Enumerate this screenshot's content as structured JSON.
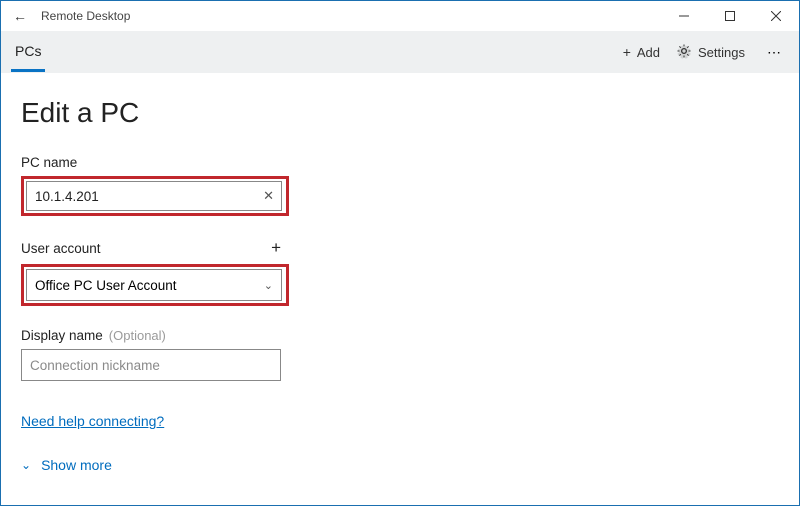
{
  "titlebar": {
    "app_name": "Remote Desktop"
  },
  "commandbar": {
    "tab_label": "PCs",
    "add_label": "Add",
    "settings_label": "Settings"
  },
  "page": {
    "title": "Edit a PC",
    "pc_name_label": "PC name",
    "pc_name_value": "10.1.4.201",
    "user_account_label": "User account",
    "user_account_value": "Office PC User Account",
    "display_name_label": "Display name",
    "display_name_optional": "(Optional)",
    "display_name_placeholder": "Connection nickname",
    "help_link_label": "Need help connecting?",
    "show_more_label": "Show more"
  }
}
